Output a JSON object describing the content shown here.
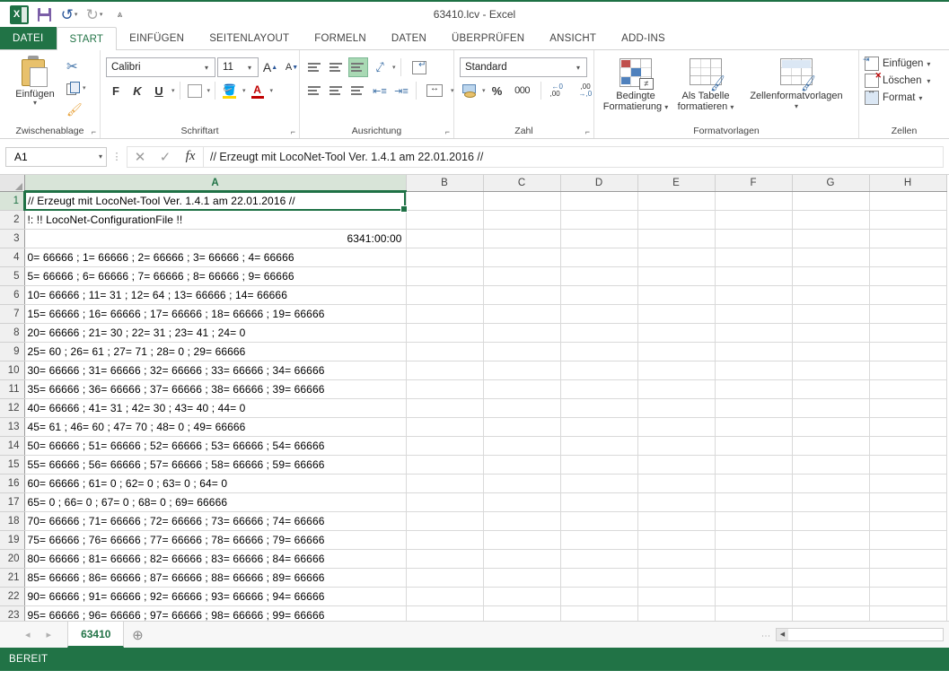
{
  "window": {
    "title": "63410.lcv - Excel"
  },
  "quick_access": {
    "items": [
      {
        "name": "excel-logo",
        "glyph": "X"
      },
      {
        "name": "save-icon",
        "glyph": ""
      },
      {
        "name": "undo-icon",
        "glyph": "↶"
      },
      {
        "name": "redo-icon",
        "glyph": "↷"
      },
      {
        "name": "customize-qat-icon",
        "glyph": "▾"
      }
    ]
  },
  "ribbon_tabs": {
    "file": "DATEI",
    "items": [
      {
        "label": "START",
        "active": true
      },
      {
        "label": "EINFÜGEN",
        "active": false
      },
      {
        "label": "SEITENLAYOUT",
        "active": false
      },
      {
        "label": "FORMELN",
        "active": false
      },
      {
        "label": "DATEN",
        "active": false
      },
      {
        "label": "ÜBERPRÜFEN",
        "active": false
      },
      {
        "label": "ANSICHT",
        "active": false
      },
      {
        "label": "ADD-INS",
        "active": false
      }
    ]
  },
  "ribbon": {
    "clipboard": {
      "group_label": "Zwischenablage",
      "paste_label": "Einfügen",
      "cut_name": "cut-icon",
      "copy_name": "copy-icon",
      "format_painter_name": "format-painter-icon"
    },
    "font": {
      "group_label": "Schriftart",
      "font_name": "Calibri",
      "font_size": "11",
      "grow_label": "A",
      "shrink_label": "A",
      "bold_label": "F",
      "italic_label": "K",
      "underline_label": "U",
      "fill_label": "A",
      "color_label": "A"
    },
    "alignment": {
      "group_label": "Ausrichtung"
    },
    "number": {
      "group_label": "Zahl",
      "format": "Standard",
      "percent_label": "%",
      "thousands_label": "000"
    },
    "styles": {
      "group_label": "Formatvorlagen",
      "conditional_l1": "Bedingte",
      "conditional_l2": "Formatierung",
      "table_l1": "Als Tabelle",
      "table_l2": "formatieren",
      "cellstyles_l1": "Zellenformatvorlagen",
      "cellstyles_l2": ""
    },
    "cells": {
      "group_label": "Zellen",
      "insert_label": "Einfügen",
      "delete_label": "Löschen",
      "format_label": "Format"
    }
  },
  "formula_bar": {
    "name_box": "A1",
    "cancel_icon": "✕",
    "accept_icon": "✓",
    "function_icon": "fx",
    "content": "// Erzeugt mit LocoNet-Tool Ver. 1.4.1 am 22.01.2016  //"
  },
  "grid": {
    "columns": [
      "A",
      "B",
      "C",
      "D",
      "E",
      "F",
      "G",
      "H"
    ],
    "selected_column": "A",
    "selected_row": 1,
    "rows": [
      {
        "n": 1,
        "a": "// Erzeugt mit LocoNet-Tool Ver. 1.4.1 am 22.01.2016  //",
        "align": "left"
      },
      {
        "n": 2,
        "a": "!:  !! LocoNet-ConfigurationFile !!",
        "align": "left"
      },
      {
        "n": 3,
        "a": "6341:00:00",
        "align": "right"
      },
      {
        "n": 4,
        "a": " 0= 66666 ;  1= 66666 ;  2= 66666 ;  3= 66666 ;  4= 66666",
        "align": "left"
      },
      {
        "n": 5,
        "a": " 5= 66666 ;  6= 66666 ;  7= 66666 ;  8= 66666 ;  9= 66666",
        "align": "left"
      },
      {
        "n": 6,
        "a": "10= 66666 ; 11=   31 ; 12=   64 ; 13= 66666 ; 14= 66666",
        "align": "left"
      },
      {
        "n": 7,
        "a": "15= 66666 ; 16= 66666 ; 17= 66666 ; 18= 66666 ; 19= 66666",
        "align": "left"
      },
      {
        "n": 8,
        "a": "20= 66666 ; 21=   30 ; 22=   31 ; 23=   41 ; 24=    0",
        "align": "left"
      },
      {
        "n": 9,
        "a": "25=   60 ; 26=   61 ; 27=   71 ; 28=    0 ; 29= 66666",
        "align": "left"
      },
      {
        "n": 10,
        "a": "30= 66666 ; 31= 66666 ; 32= 66666 ; 33= 66666 ; 34= 66666",
        "align": "left"
      },
      {
        "n": 11,
        "a": "35= 66666 ; 36= 66666 ; 37= 66666 ; 38= 66666 ; 39= 66666",
        "align": "left"
      },
      {
        "n": 12,
        "a": "40= 66666 ; 41=   31 ; 42=   30 ; 43=   40 ; 44=    0",
        "align": "left"
      },
      {
        "n": 13,
        "a": "45=   61 ; 46=   60 ; 47=   70 ; 48=    0 ; 49= 66666",
        "align": "left"
      },
      {
        "n": 14,
        "a": "50= 66666 ; 51= 66666 ; 52= 66666 ; 53= 66666 ; 54= 66666",
        "align": "left"
      },
      {
        "n": 15,
        "a": "55= 66666 ; 56= 66666 ; 57= 66666 ; 58= 66666 ; 59= 66666",
        "align": "left"
      },
      {
        "n": 16,
        "a": "60= 66666 ; 61=    0 ; 62=    0 ; 63=    0 ; 64=    0",
        "align": "left"
      },
      {
        "n": 17,
        "a": "65=    0 ; 66=    0 ; 67=    0 ; 68=    0 ; 69= 66666",
        "align": "left"
      },
      {
        "n": 18,
        "a": "70= 66666 ; 71= 66666 ; 72= 66666 ; 73= 66666 ; 74= 66666",
        "align": "left"
      },
      {
        "n": 19,
        "a": "75= 66666 ; 76= 66666 ; 77= 66666 ; 78= 66666 ; 79= 66666",
        "align": "left"
      },
      {
        "n": 20,
        "a": "80= 66666 ; 81= 66666 ; 82= 66666 ; 83= 66666 ; 84= 66666",
        "align": "left"
      },
      {
        "n": 21,
        "a": "85= 66666 ; 86= 66666 ; 87= 66666 ; 88= 66666 ; 89= 66666",
        "align": "left"
      },
      {
        "n": 22,
        "a": "90= 66666 ; 91= 66666 ; 92= 66666 ; 93= 66666 ; 94= 66666",
        "align": "left"
      },
      {
        "n": 23,
        "a": "95= 66666 ; 96= 66666 ; 97= 66666 ; 98= 66666 ; 99= 66666",
        "align": "left"
      }
    ]
  },
  "sheet_bar": {
    "prev_icon": "◂",
    "next_icon": "▸",
    "sheets": [
      {
        "name": "63410",
        "active": true
      }
    ],
    "add_icon": "⊕",
    "scroll_left_icon": "◀"
  },
  "status_bar": {
    "text": "BEREIT"
  },
  "colors": {
    "accent_green": "#217346",
    "dark_green": "#1e7145",
    "selection_green": "#d8e4d8"
  }
}
